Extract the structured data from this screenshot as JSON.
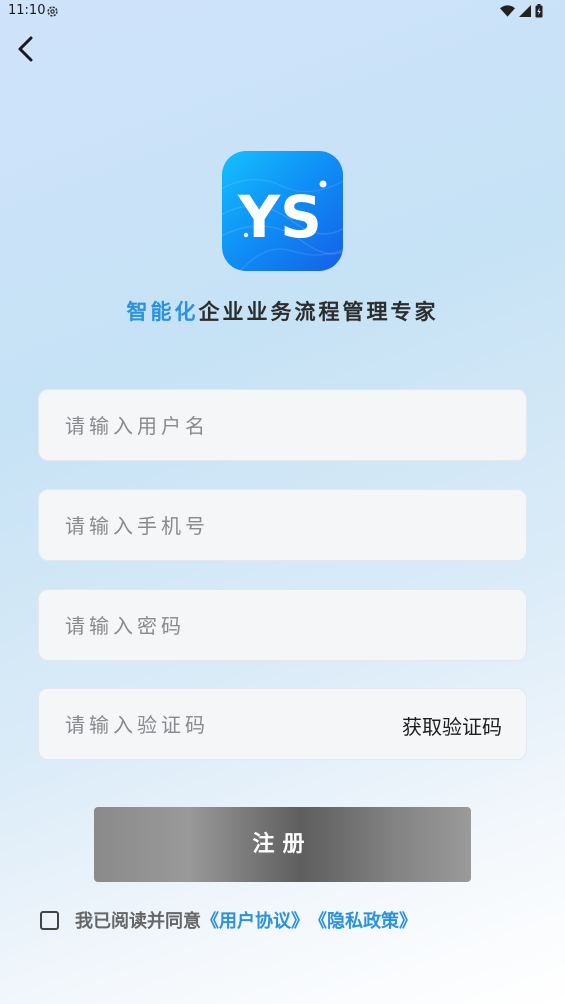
{
  "status_bar": {
    "time": "11:10",
    "icons": [
      "gear-icon",
      "wifi-icon",
      "signal-icon",
      "battery-icon"
    ]
  },
  "header": {
    "back_icon": "chevron-left-icon"
  },
  "logo": {
    "text": "YS",
    "colors": [
      "#14c0ff",
      "#0f8df5",
      "#1560e8"
    ]
  },
  "slogan": {
    "parts": [
      {
        "text": "智能化",
        "color": "#2a93dc"
      },
      {
        "text": "企业业务流程管理专家",
        "color": "#2c2c2c"
      }
    ]
  },
  "form": {
    "username": {
      "placeholder": "请输入用户名",
      "value": ""
    },
    "phone": {
      "placeholder": "请输入手机号",
      "value": ""
    },
    "password": {
      "placeholder": "请输入密码",
      "value": ""
    },
    "code": {
      "placeholder": "请输入验证码",
      "value": ""
    },
    "get_code_label": "获取验证码"
  },
  "register_button": {
    "label": "注册"
  },
  "agreement": {
    "checked": false,
    "text": "我已阅读并同意",
    "user_agreement": "《用户协议》",
    "privacy_policy": "《隐私政策》",
    "link_color": "#2a93dc"
  }
}
